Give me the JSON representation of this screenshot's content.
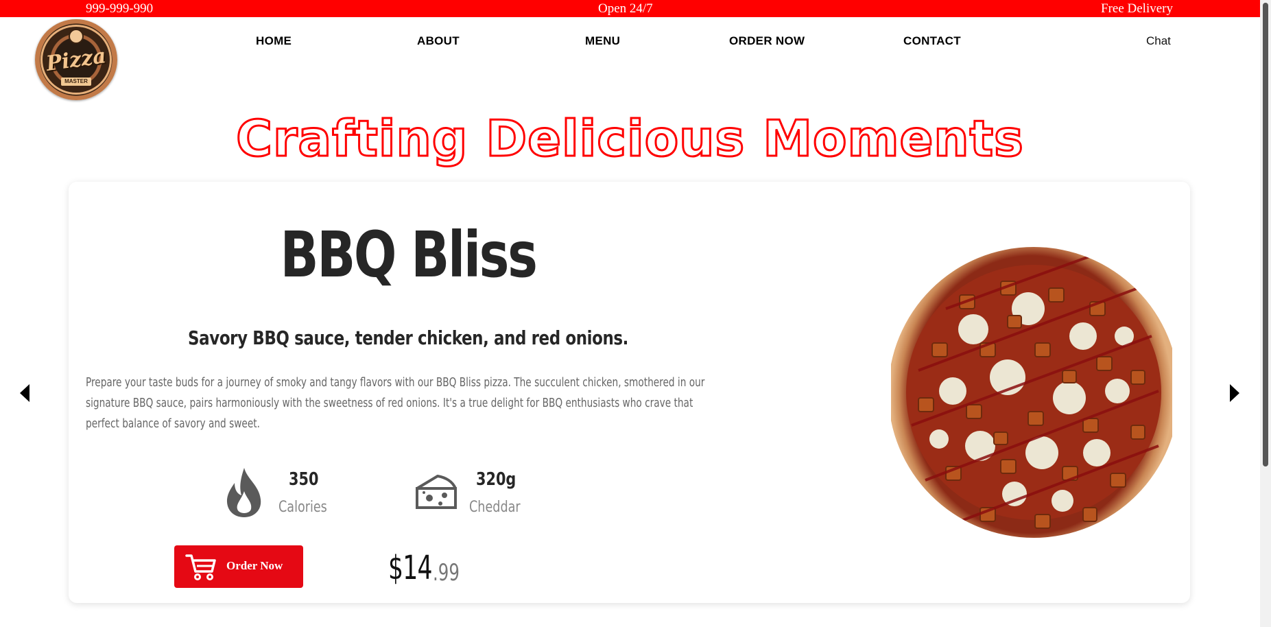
{
  "topbar": {
    "phone": "999-999-990",
    "hours": "Open 24/7",
    "delivery": "Free Delivery"
  },
  "logo": {
    "word": "Pizza",
    "sub": "MASTER"
  },
  "nav": {
    "home": "HOME",
    "about": "ABOUT",
    "menu": "MENU",
    "order": "ORDER NOW",
    "contact": "CONTACT",
    "chat": "Chat"
  },
  "hero": {
    "headline": "Crafting Delicious Moments"
  },
  "product": {
    "name": "BBQ Bliss",
    "tagline": "Savory BBQ sauce, tender chicken, and red onions.",
    "description": "Prepare your taste buds for a journey of smoky and tangy flavors with our BBQ Bliss pizza. The succulent chicken, smothered in our signature BBQ sauce, pairs harmoniously with the sweetness of red onions. It's a true delight for BBQ enthusiasts who crave that perfect balance of savory and sweet.",
    "stats": [
      {
        "icon": "flame-icon",
        "value": "350",
        "label": "Calories"
      },
      {
        "icon": "cheese-icon",
        "value": "320g",
        "label": "Cheddar"
      }
    ],
    "order_label": "Order Now",
    "price_dollars": "$14",
    "price_cents": ".99"
  },
  "colors": {
    "accent": "#ff0000",
    "button": "#e50914",
    "text_dark": "#262626",
    "text_muted": "#666666"
  }
}
